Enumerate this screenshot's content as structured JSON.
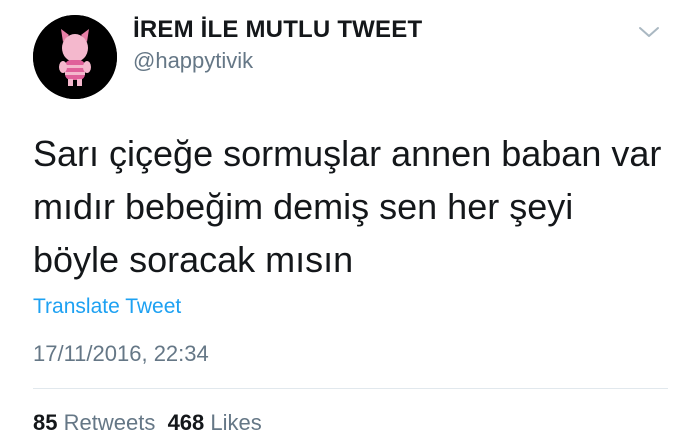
{
  "tweet": {
    "display_name": "İREM İLE MUTLU TWEET",
    "handle": "@happytivik",
    "text": "Sarı çiçeğe sormuşlar annen baban var mıdır bebeğim demiş sen her şeyi böyle soracak mısın",
    "translate_label": "Translate Tweet",
    "timestamp": "17/11/2016, 22:34",
    "retweets_count": "85",
    "retweets_label": "Retweets",
    "likes_count": "468",
    "likes_label": "Likes"
  },
  "icons": {
    "menu": "chevron-down-icon",
    "avatar": "avatar"
  },
  "colors": {
    "link": "#1da1f2",
    "secondary_text": "#657786",
    "primary_text": "#14171a",
    "divider": "#e1e8ed",
    "avatar_bg": "#000000",
    "avatar_character": "#f29fc0"
  }
}
